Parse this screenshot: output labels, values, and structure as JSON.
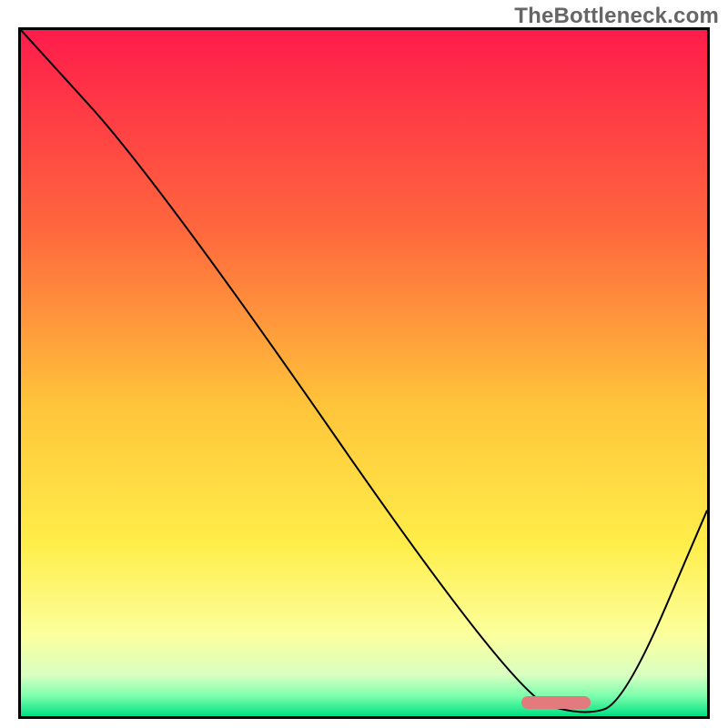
{
  "watermark": "TheBottleneck.com",
  "chart_data": {
    "type": "line",
    "title": "",
    "xlabel": "",
    "ylabel": "",
    "xlim": [
      0,
      100
    ],
    "ylim": [
      0,
      100
    ],
    "grid": false,
    "legend": false,
    "series": [
      {
        "name": "bottleneck-curve",
        "x": [
          0,
          20,
          72,
          82,
          88,
          100
        ],
        "y": [
          100,
          78,
          3,
          0,
          2,
          30
        ]
      }
    ],
    "marker": {
      "name": "optimal-range",
      "x_start": 73,
      "x_end": 83,
      "y": 1
    },
    "background_gradient": {
      "stops": [
        {
          "pos": 0,
          "color": "#ff1c4b"
        },
        {
          "pos": 30,
          "color": "#ff6a3d"
        },
        {
          "pos": 55,
          "color": "#ffc53a"
        },
        {
          "pos": 75,
          "color": "#ffee4a"
        },
        {
          "pos": 88,
          "color": "#fcff9c"
        },
        {
          "pos": 94,
          "color": "#d9ffc2"
        },
        {
          "pos": 97,
          "color": "#7fffad"
        },
        {
          "pos": 100,
          "color": "#00e083"
        }
      ]
    }
  }
}
